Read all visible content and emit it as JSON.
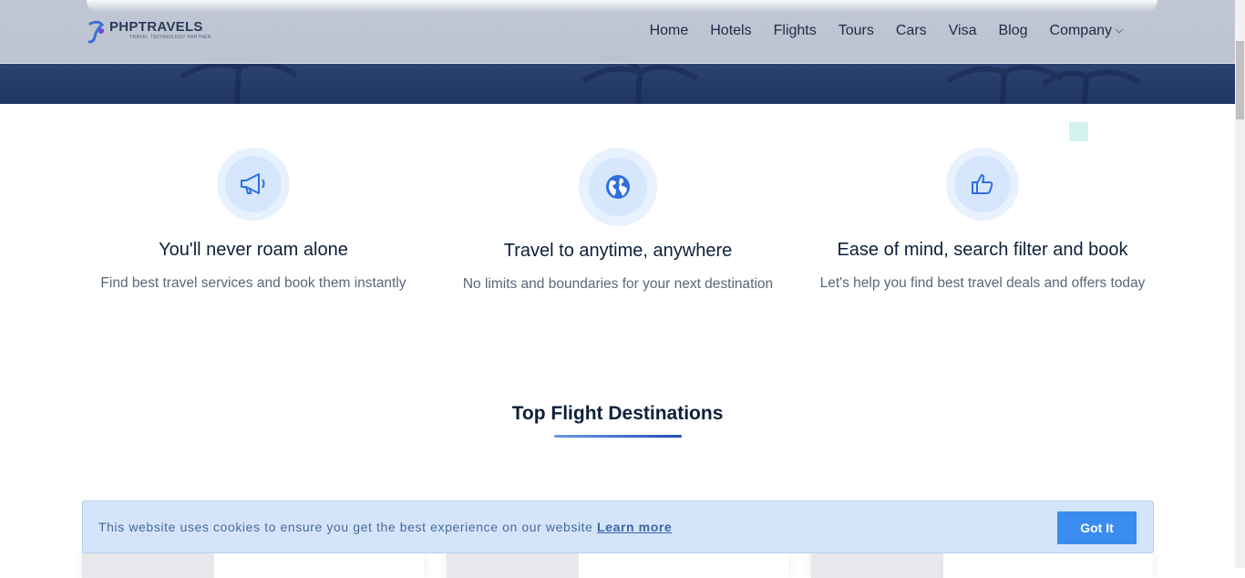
{
  "header": {
    "logo_title": "PHPTRAVELS",
    "logo_tagline": "TRAVEL TECHNOLOGY PARTNER",
    "nav": [
      {
        "label": "Home"
      },
      {
        "label": "Hotels"
      },
      {
        "label": "Flights"
      },
      {
        "label": "Tours"
      },
      {
        "label": "Cars"
      },
      {
        "label": "Visa"
      },
      {
        "label": "Blog"
      },
      {
        "label": "Company"
      }
    ]
  },
  "features": [
    {
      "icon": "megaphone-icon",
      "title": "You'll never roam alone",
      "description": "Find best travel services and book them instantly"
    },
    {
      "icon": "globe-icon",
      "title": "Travel to anytime, anywhere",
      "description": "No limits and boundaries for your next destination"
    },
    {
      "icon": "thumbs-up-icon",
      "title": "Ease of mind, search filter and book",
      "description": "Let's help you find best travel deals and offers today"
    }
  ],
  "section": {
    "title": "Top Flight Destinations"
  },
  "cookie": {
    "message": "This website uses cookies to ensure you get the best experience on our website",
    "link_label": "Learn more",
    "button_label": "Got It"
  },
  "colors": {
    "accent": "#3b8cf0",
    "icon_blue": "#2f6fe0",
    "title_text": "#0e1f3a",
    "cookie_bg": "#d4e5fb"
  }
}
